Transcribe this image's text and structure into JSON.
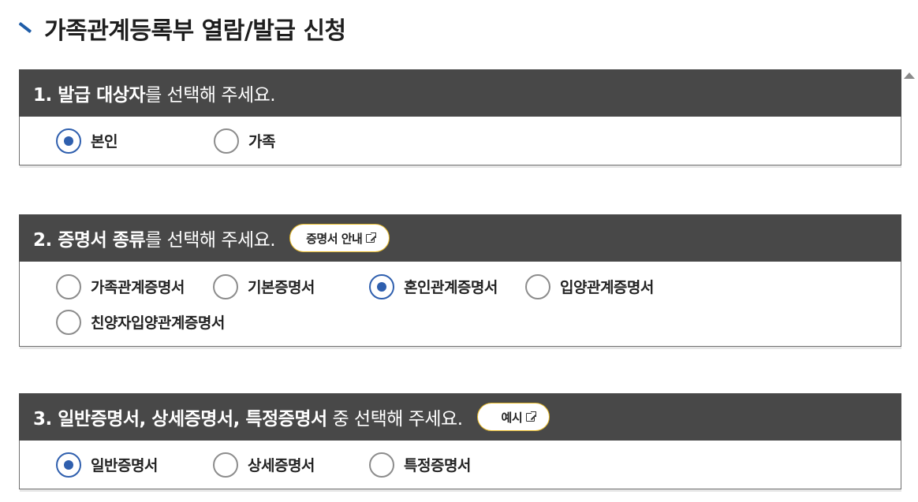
{
  "page": {
    "title": "가족관계등록부 열람/발급 신청"
  },
  "sections": [
    {
      "q_bold": "1. 발급 대상자",
      "q_normal": "를 선택해 주세요.",
      "options": [
        {
          "label": "본인",
          "checked": true
        },
        {
          "label": "가족",
          "checked": false
        }
      ]
    },
    {
      "q_bold": "2. 증명서 종류",
      "q_normal": "를 선택해 주세요.",
      "info_button": "증명서 안내",
      "options": [
        {
          "label": "가족관계증명서",
          "checked": false
        },
        {
          "label": "기본증명서",
          "checked": false
        },
        {
          "label": "혼인관계증명서",
          "checked": true
        },
        {
          "label": "입양관계증명서",
          "checked": false
        },
        {
          "label": "친양자입양관계증명서",
          "checked": false
        }
      ]
    },
    {
      "q_bold": "3. 일반증명서, 상세증명서, 특정증명서",
      "q_normal": " 중 선택해 주세요.",
      "info_button": "예시",
      "options": [
        {
          "label": "일반증명서",
          "checked": true
        },
        {
          "label": "상세증명서",
          "checked": false
        },
        {
          "label": "특정증명서",
          "checked": false
        }
      ]
    }
  ],
  "colors": {
    "header_bg": "#484848",
    "accent": "#2f5fae",
    "button_border": "#e5b825"
  }
}
